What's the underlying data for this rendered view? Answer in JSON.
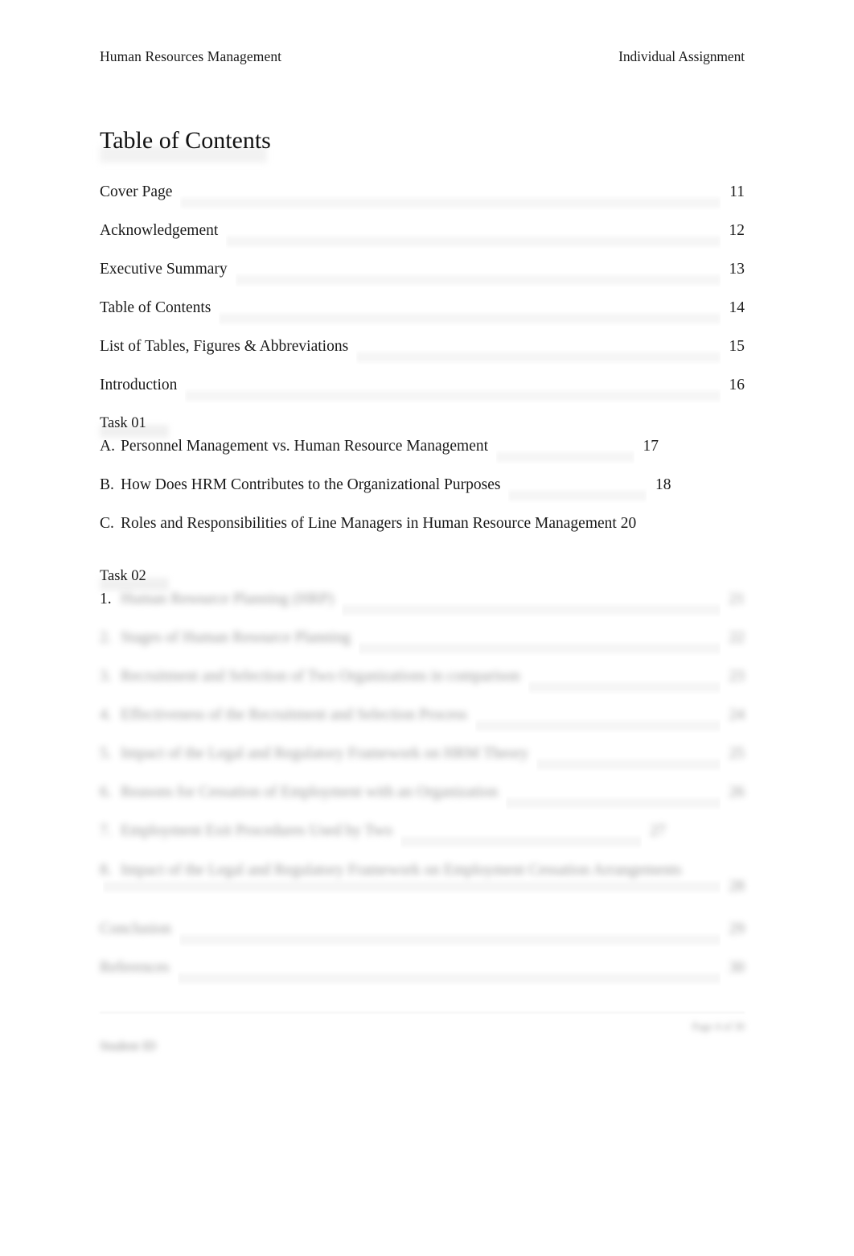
{
  "header": {
    "left": "Human Resources Management",
    "right": "Individual Assignment"
  },
  "title": "Table of Contents",
  "front_matter": [
    {
      "label": "Cover Page",
      "page": "11"
    },
    {
      "label": "Acknowledgement",
      "page": "12"
    },
    {
      "label": "Executive Summary",
      "page": "13"
    },
    {
      "label": "Table of Contents",
      "page": "14"
    },
    {
      "label": "List of Tables, Figures & Abbreviations",
      "page": "15"
    },
    {
      "label": "Introduction",
      "page": "16"
    }
  ],
  "task01": {
    "heading": "Task 01",
    "items": [
      {
        "num": "A.",
        "label": "Personnel Management vs. Human Resource Management",
        "page": "17"
      },
      {
        "num": "B.",
        "label": "How Does HRM Contributes to the Organizational Purposes",
        "page": "18"
      },
      {
        "num": "C.",
        "label": "Roles and Responsibilities of Line Managers in Human Resource Management 20",
        "page": ""
      }
    ]
  },
  "task02": {
    "heading": "Task 02",
    "items": [
      {
        "num": "1.",
        "label": "Human Resource Planning (HRP)",
        "page": "21"
      },
      {
        "num": "2.",
        "label": "Stages of Human Resource Planning",
        "page": "22"
      },
      {
        "num": "3.",
        "label": "Recruitment and Selection of Two Organizations in comparison",
        "page": "23"
      },
      {
        "num": "4.",
        "label": "Effectiveness of the Recruitment and Selection Process",
        "page": "24"
      },
      {
        "num": "5.",
        "label": "Impact of the Legal and Regulatory Framework on HRM Theory",
        "page": "25"
      },
      {
        "num": "6.",
        "label": "Reasons for Cessation of Employment with an Organization",
        "page": "26"
      },
      {
        "num": "7.",
        "label": "Employment Exit Procedures Used by Two",
        "page": "27"
      },
      {
        "num": "8.",
        "label": "Impact of the Legal and Regulatory Framework on Employment Cessation Arrangements",
        "page": "28"
      }
    ]
  },
  "back_matter": [
    {
      "label": "Conclusion",
      "page": "29"
    },
    {
      "label": "References",
      "page": "30"
    }
  ],
  "footer": {
    "right": "Page 4 of 30",
    "left": "Student ID"
  }
}
